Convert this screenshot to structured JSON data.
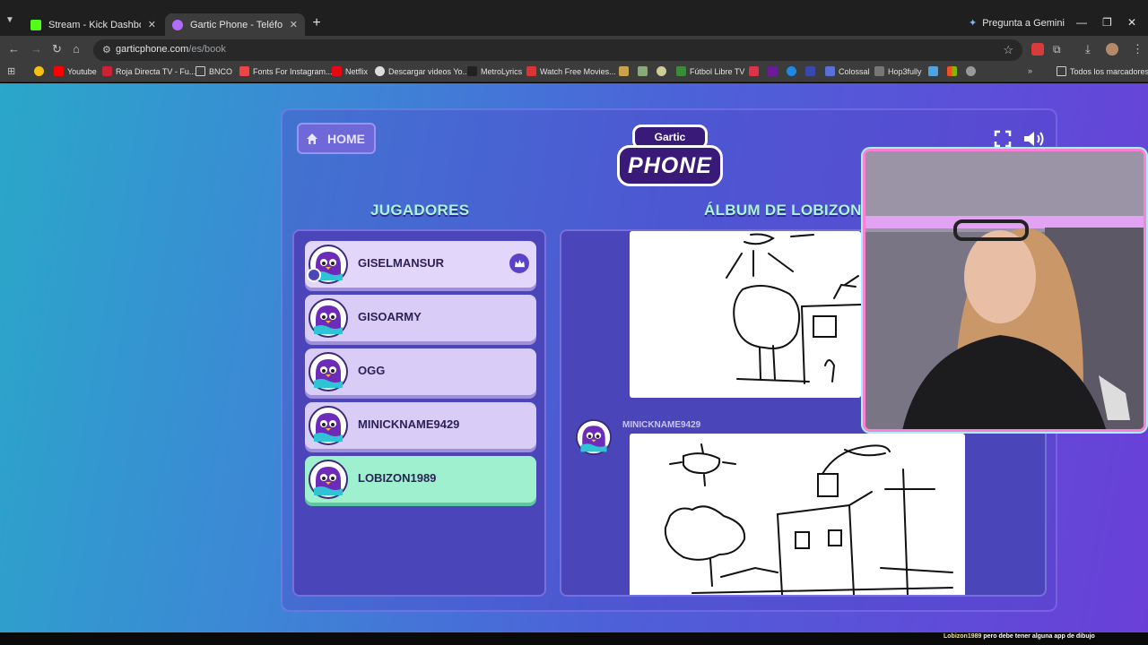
{
  "browser": {
    "tabs": [
      {
        "title": "Stream - Kick Dashboard",
        "active": false,
        "favicon_color": "#53fc18"
      },
      {
        "title": "Gartic Phone - Teléfono Descon",
        "active": true,
        "favicon_color": "#b16cff"
      }
    ],
    "gemini_label": "Pregunta a Gemini",
    "url_host": "garticphone.com",
    "url_path": "/es/book",
    "bookmarks": [
      "Youtube",
      "Roja Directa TV - Fu...",
      "BNCO",
      "Fonts For Instagram...",
      "Netflix",
      "Descargar videos Yo...",
      "MetroLyrics",
      "Watch Free Movies...",
      "Fútbol Libre TV",
      "Colossal",
      "Hop3fully"
    ],
    "all_bookmarks_label": "Todos los marcadores"
  },
  "game": {
    "home_label": "HOME",
    "logo_top": "Gartic",
    "logo_main": "PHONE",
    "players_header": "JUGADORES",
    "album_header": "ÁLBUM DE LOBIZON",
    "players": [
      {
        "name": "GISELMANSUR",
        "host": true
      },
      {
        "name": "GISOARMY",
        "host": false
      },
      {
        "name": "OGG",
        "host": false
      },
      {
        "name": "MINICKNAME9429",
        "host": false
      },
      {
        "name": "LOBIZON1989",
        "host": false,
        "current": true
      }
    ],
    "album_entries": [
      {
        "author": "",
        "type": "drawing"
      },
      {
        "author": "MINICKNAME9429",
        "type": "drawing"
      }
    ]
  },
  "chat": {
    "user": "Lobizon1989",
    "message": "pero debe tener alguna app de dibujo"
  },
  "colors": {
    "accent_mint": "#9ff0cf",
    "player_card": "#d9ccf7",
    "panel": "#4a45b8",
    "header_text": "#a9f5d6"
  }
}
